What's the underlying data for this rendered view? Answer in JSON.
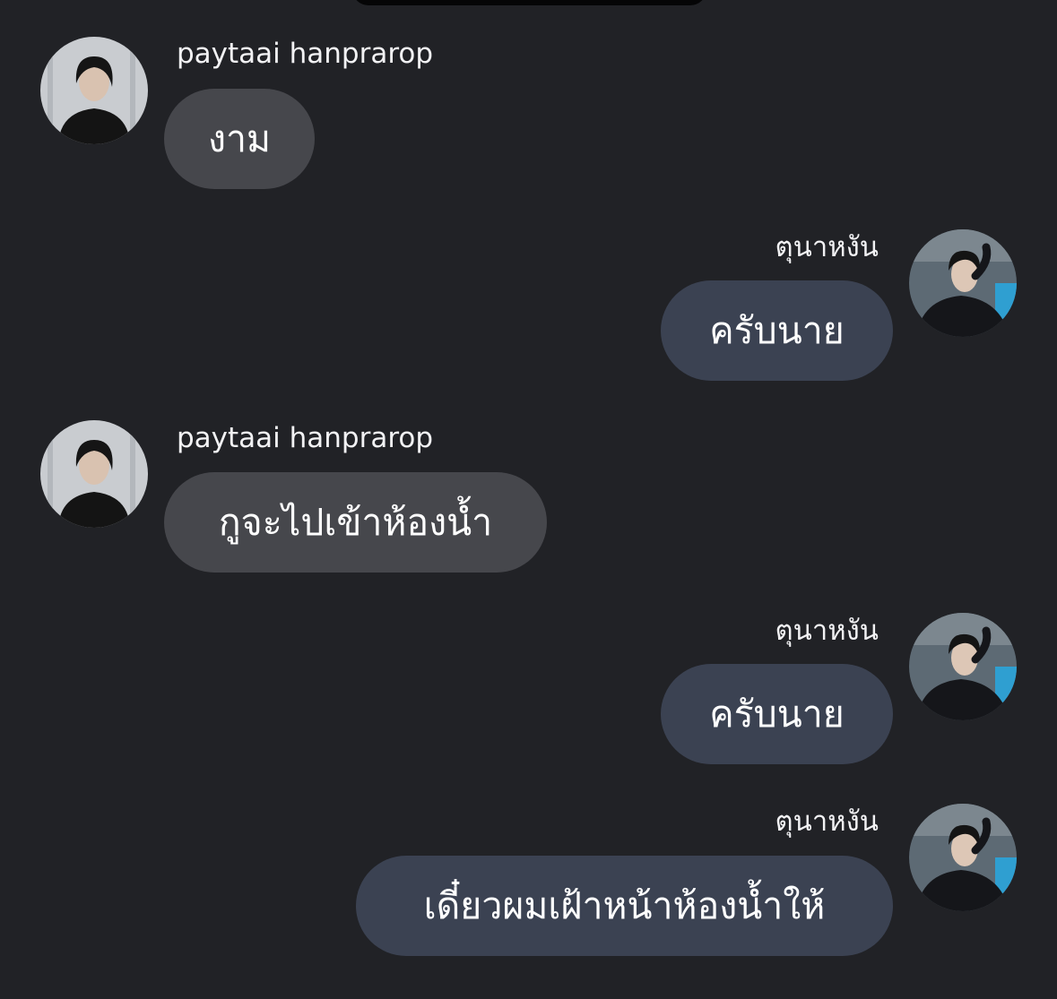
{
  "messages": [
    {
      "direction": "incoming",
      "sender": "paytaai hanprarop",
      "avatar_icon": "user-avatar-icon",
      "text": "งาม"
    },
    {
      "direction": "outgoing",
      "sender": "ตุนาหงัน",
      "avatar_icon": "user-avatar-icon",
      "text": "ครับนาย"
    },
    {
      "direction": "incoming",
      "sender": "paytaai hanprarop",
      "avatar_icon": "user-avatar-icon",
      "text": "กูจะไปเข้าห้องน้ำ"
    },
    {
      "direction": "outgoing",
      "sender": "ตุนาหงัน",
      "avatar_icon": "user-avatar-icon",
      "text": "ครับนาย"
    },
    {
      "direction": "outgoing",
      "sender": "ตุนาหงัน",
      "avatar_icon": "user-avatar-icon",
      "text": "เดี๋ยวผมเฝ้าหน้าห้องน้ำให้"
    }
  ],
  "colors": {
    "background": "#212226",
    "incoming_bubble": "#46474c",
    "outgoing_bubble": "#3b4252",
    "text": "#ffffff"
  }
}
